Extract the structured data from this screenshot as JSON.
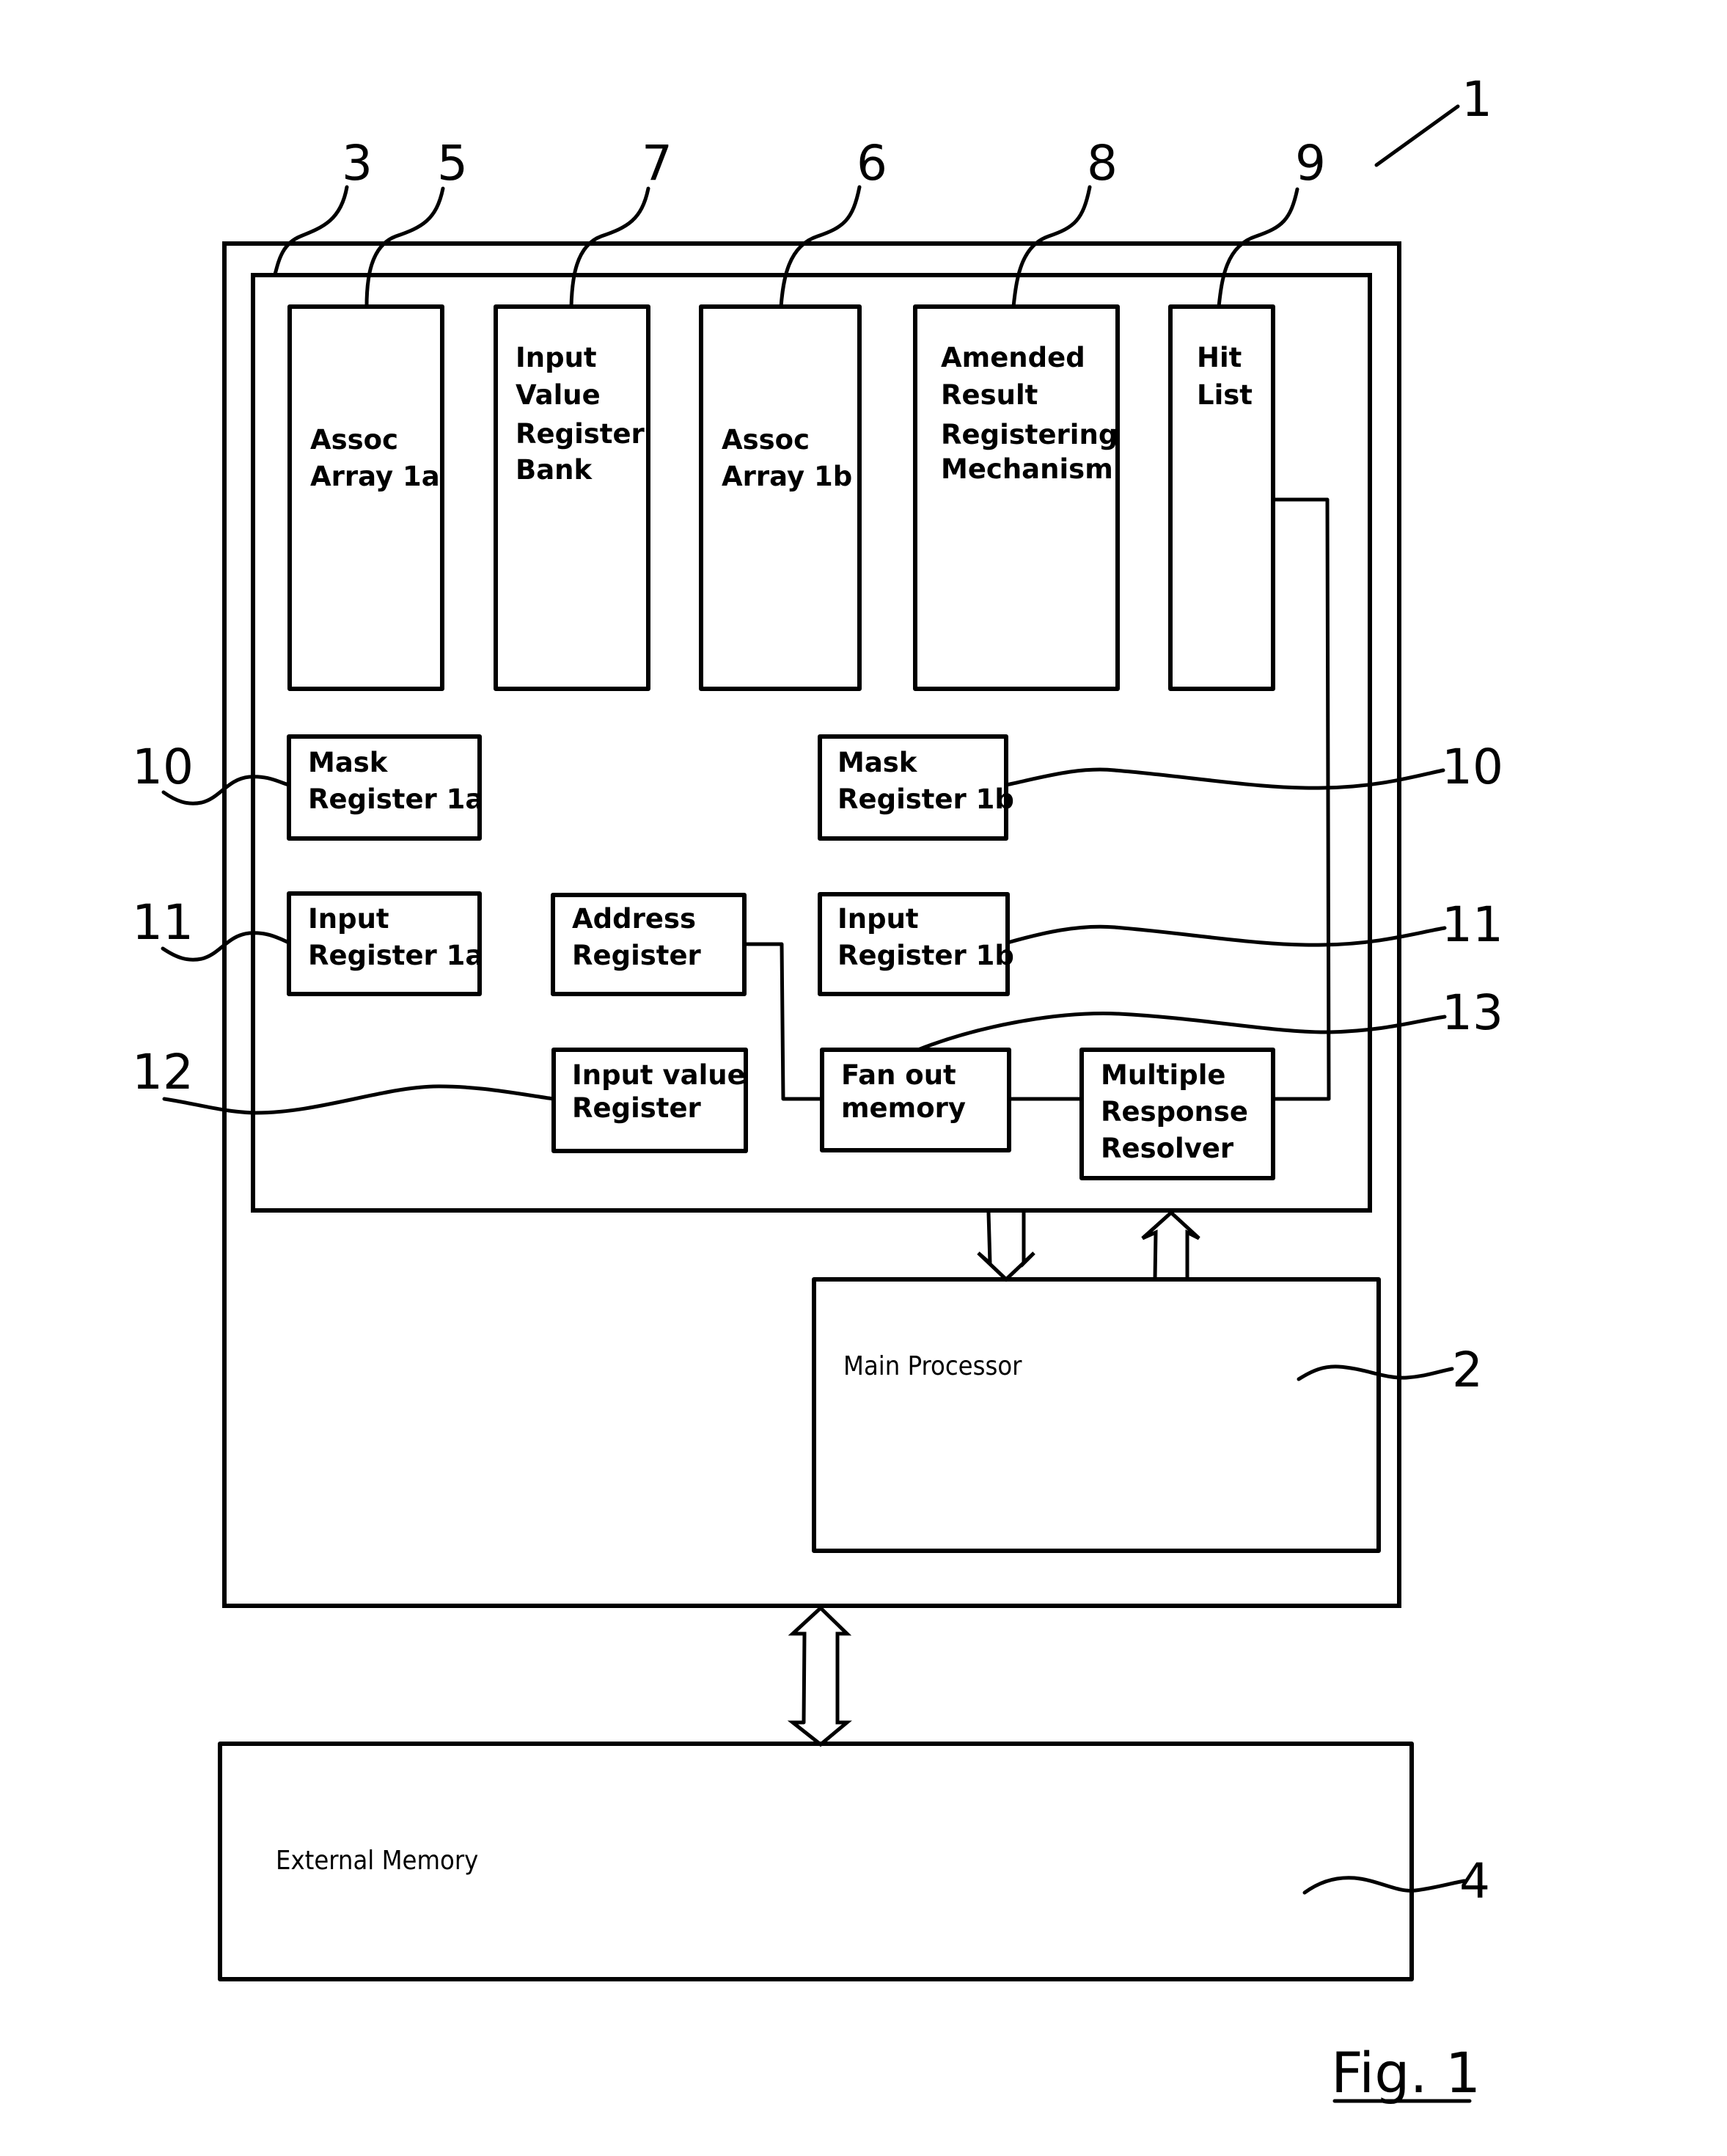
{
  "figure": {
    "caption": "Fig. 1",
    "system_ref": "1"
  },
  "blocks": {
    "assoc_array_1a": {
      "ref": "5",
      "lines": [
        "Assoc",
        "Array 1a"
      ]
    },
    "input_value_register_bank": {
      "ref": "7",
      "lines": [
        "Input",
        "Value",
        "Register",
        "Bank"
      ]
    },
    "assoc_array_1b": {
      "ref": "6",
      "lines": [
        "Assoc",
        "Array 1b"
      ]
    },
    "amended_result": {
      "ref": "8",
      "lines": [
        "Amended",
        "Result",
        "Registering",
        "Mechanism"
      ]
    },
    "hit_list": {
      "ref": "9",
      "lines": [
        "Hit",
        "List"
      ]
    },
    "mask_register_1a": {
      "ref": "10",
      "lines": [
        "Mask",
        "Register 1a"
      ]
    },
    "mask_register_1b": {
      "ref": "10",
      "lines": [
        "Mask",
        "Register 1b"
      ]
    },
    "input_register_1a": {
      "ref": "11",
      "lines": [
        "Input",
        "Register 1a"
      ]
    },
    "address_register": {
      "lines": [
        "Address",
        "Register"
      ]
    },
    "input_register_1b": {
      "ref": "11",
      "lines": [
        "Input",
        "Register 1b"
      ]
    },
    "input_value_register": {
      "ref": "12",
      "lines": [
        "Input value",
        "Register"
      ]
    },
    "fan_out_memory": {
      "ref": "13",
      "lines": [
        "Fan out",
        "memory"
      ]
    },
    "multiple_response_resolver": {
      "lines": [
        "Multiple",
        "Response",
        "Resolver"
      ]
    },
    "main_processor": {
      "ref": "2",
      "label": "Main Processor"
    },
    "external_memory": {
      "ref": "4",
      "label": "External Memory"
    },
    "associative_unit": {
      "ref": "3"
    }
  },
  "refs": {
    "r1": "1",
    "r2": "2",
    "r3": "3",
    "r4": "4",
    "r5": "5",
    "r6": "6",
    "r7": "7",
    "r8": "8",
    "r9": "9",
    "r10_left": "10",
    "r10_right": "10",
    "r11_left": "11",
    "r11_right": "11",
    "r12": "12",
    "r13": "13"
  }
}
